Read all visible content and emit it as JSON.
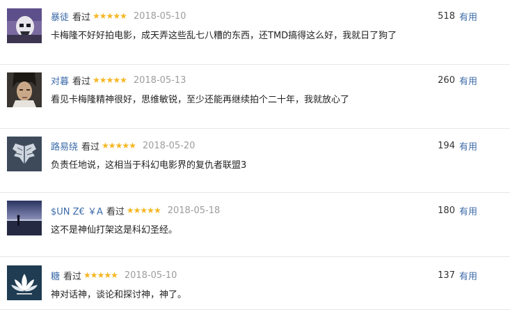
{
  "colors": {
    "username": "#3b6aa8",
    "star": "#f5b622",
    "date": "#9c9c9c",
    "useful_link": "#3b6aa8",
    "divider": "#e6e6e6"
  },
  "reviews": [
    {
      "username": "暴徒",
      "status": "看过",
      "rating_stars": 5,
      "date": "2018-05-10",
      "content": "卡梅隆不好好拍电影，成天弄这些乱七八糟的东西，还TMD搞得这么好，我就日了狗了",
      "useful_count": "518",
      "useful_label": "有用",
      "avatar": "stormtrooper-avatar"
    },
    {
      "username": "对暮",
      "status": "看过",
      "rating_stars": 5,
      "date": "2018-05-13",
      "content": "看见卡梅隆精神很好，思维敏锐，至少还能再继续拍个二十年，我就放心了",
      "useful_count": "260",
      "useful_label": "有用",
      "avatar": "portrait-avatar"
    },
    {
      "username": "路易绕",
      "status": "看过",
      "rating_stars": 5,
      "date": "2018-05-20",
      "content": "负责任地说，这相当于科幻电影界的复仇者联盟3",
      "useful_count": "194",
      "useful_label": "有用",
      "avatar": "wings-avatar"
    },
    {
      "username": "$UN Z€ ￥A",
      "status": "看过",
      "rating_stars": 5,
      "date": "2018-05-18",
      "content": "这不是神仙打架这是科幻圣经。",
      "useful_count": "180",
      "useful_label": "有用",
      "avatar": "sunset-avatar"
    },
    {
      "username": "糖",
      "status": "看过",
      "rating_stars": 5,
      "date": "2018-05-10",
      "content": "神对话神，谈论和探讨神，神了。",
      "useful_count": "137",
      "useful_label": "有用",
      "avatar": "lotus-avatar"
    }
  ]
}
